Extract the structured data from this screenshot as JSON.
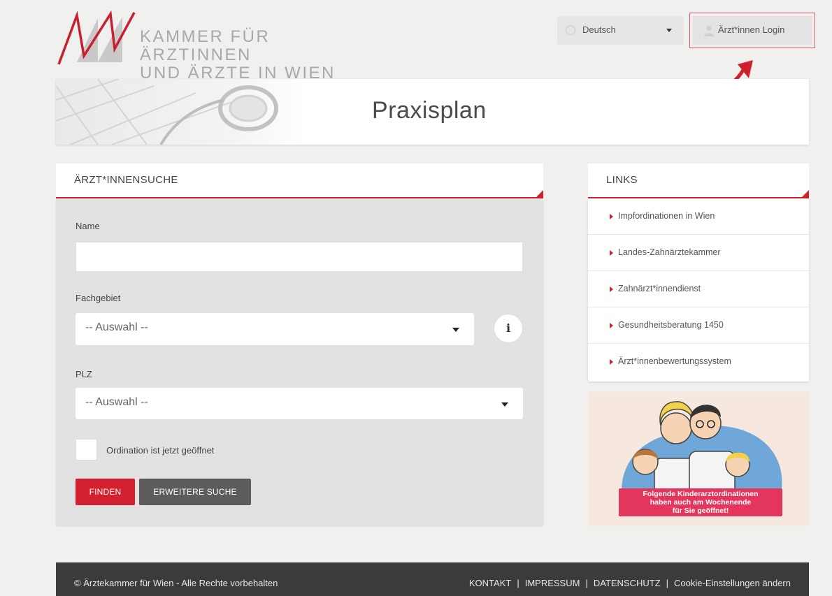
{
  "header": {
    "logo_line1": "KAMMER FÜR ÄRZTINNEN",
    "logo_line2": "UND ÄRZTE IN WIEN",
    "language": "Deutsch",
    "login_label": "Ärzt*innen Login"
  },
  "banner": {
    "title": "Praxisplan"
  },
  "search": {
    "heading": "ÄRZT*INNENSUCHE",
    "name_label": "Name",
    "name_value": "",
    "specialty_label": "Fachgebiet",
    "specialty_value": "-- Auswahl --",
    "zip_label": "PLZ",
    "zip_value": "-- Auswahl --",
    "open_now_label": "Ordination ist jetzt geöffnet",
    "find_label": "FINDEN",
    "extended_label": "ERWEITERE SUCHE",
    "info_symbol": "i"
  },
  "links": {
    "heading": "LINKS",
    "items": [
      {
        "label": "Impfordinationen in Wien"
      },
      {
        "label": "Landes-Zahnärztekammer"
      },
      {
        "label": "Zahnärzt*innendienst"
      },
      {
        "label": "Gesundheitsberatung 1450"
      },
      {
        "label": "Ärzt*innenbewertungssystem"
      }
    ]
  },
  "promo": {
    "line1": "Folgende Kinderarztordinationen",
    "line2": "haben auch am Wochenende",
    "line3": "für Sie geöffnet!"
  },
  "footer": {
    "copyright": "© Ärztekammer für Wien - Alle Rechte vorbehalten",
    "links": [
      "KONTAKT",
      "IMPRESSUM",
      "DATENSCHUTZ",
      "Cookie-Einstellungen ändern"
    ],
    "separator": "|"
  },
  "colors": {
    "accent": "#d0202e",
    "button_secondary": "#5c5c5c",
    "footer_bg": "#3b3b3b",
    "page_bg": "#f0f0ef"
  },
  "icons": {
    "language": "globe-icon",
    "login": "user-icon",
    "specialty_caret": "chevron-down-icon",
    "info": "info-icon",
    "link_bullet": "triangle-right-icon"
  }
}
